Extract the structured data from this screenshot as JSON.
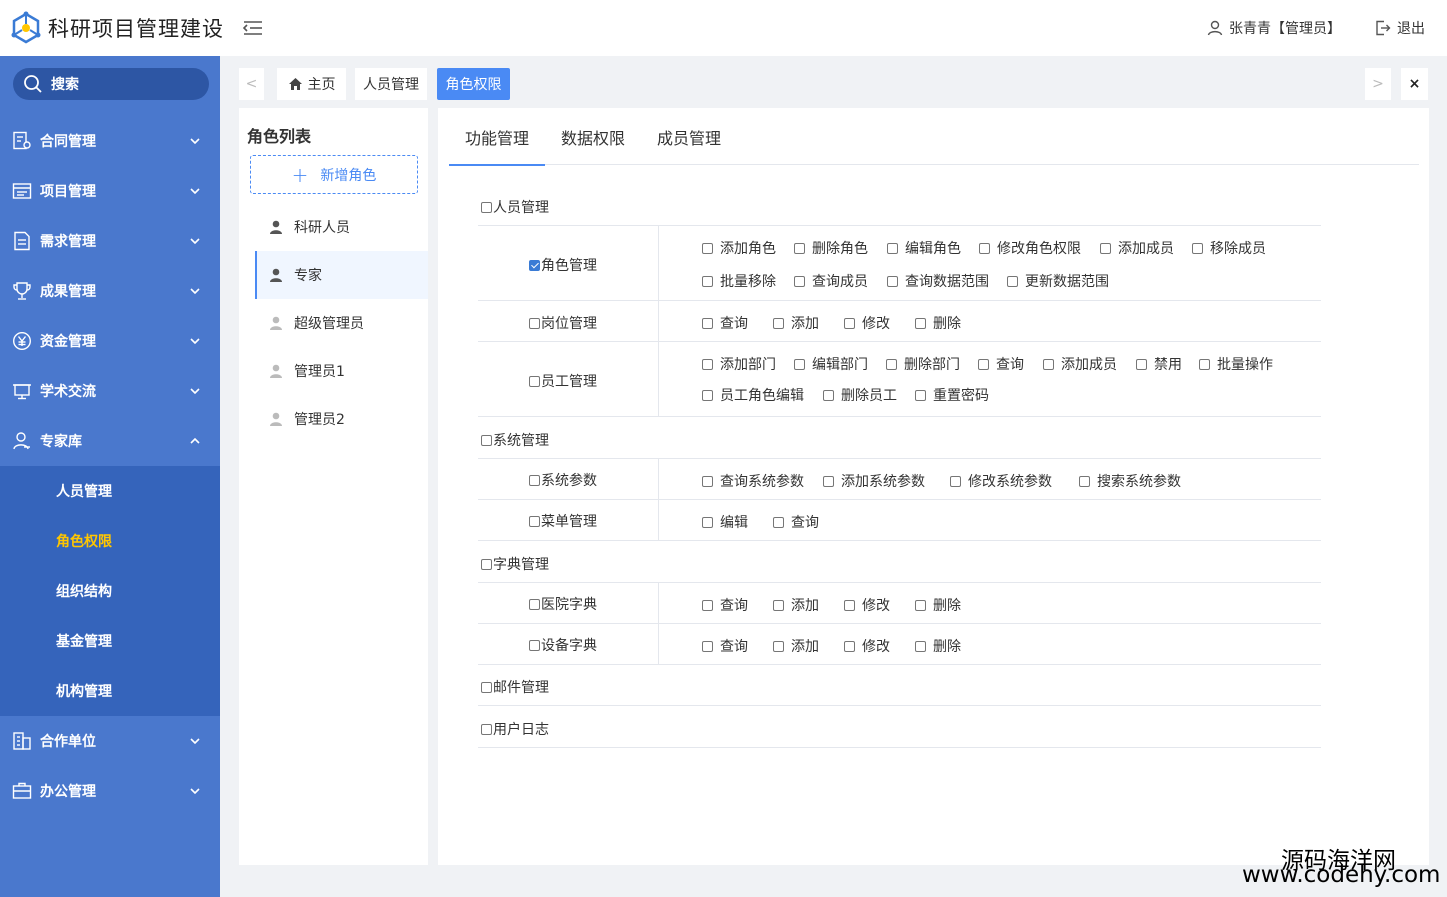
{
  "header": {
    "app_title": "科研项目管理建设",
    "user": "张青青【管理员】",
    "logout": "退出"
  },
  "sidebar": {
    "search": "搜索",
    "items": [
      {
        "label": "合同管理",
        "icon": "contract-icon"
      },
      {
        "label": "项目管理",
        "icon": "project-icon"
      },
      {
        "label": "需求管理",
        "icon": "document-icon"
      },
      {
        "label": "成果管理",
        "icon": "trophy-icon"
      },
      {
        "label": "资金管理",
        "icon": "yen-icon"
      },
      {
        "label": "学术交流",
        "icon": "monitor-icon"
      },
      {
        "label": "专家库",
        "icon": "expert-icon"
      },
      {
        "label": "合作单位",
        "icon": "building-icon"
      },
      {
        "label": "办公管理",
        "icon": "briefcase-icon"
      }
    ],
    "submenu": [
      "人员管理",
      "角色权限",
      "组织结构",
      "基金管理",
      "机构管理"
    ]
  },
  "tabs": {
    "prev": "<",
    "next": ">",
    "close": "×",
    "home": "主页",
    "people": "人员管理",
    "role": "角色权限"
  },
  "role_panel": {
    "title": "角色列表",
    "add_button": "新增角色",
    "roles": [
      "科研人员",
      "专家",
      "超级管理员",
      "管理员1",
      "管理员2"
    ]
  },
  "main_tabs": [
    "功能管理",
    "数据权限",
    "成员管理"
  ],
  "permissions": {
    "groups": [
      {
        "label": "人员管理",
        "checked": false
      },
      {
        "label": "系统管理",
        "checked": false
      },
      {
        "label": "字典管理",
        "checked": false
      },
      {
        "label": "邮件管理",
        "checked": false
      },
      {
        "label": "用户日志",
        "checked": false
      }
    ],
    "subs": [
      {
        "label": "角色管理",
        "checked": true,
        "ops": [
          "添加角色",
          "删除角色",
          "编辑角色",
          "修改角色权限",
          "添加成员",
          "移除成员",
          "批量移除",
          "查询成员",
          "查询数据范围",
          "更新数据范围"
        ]
      },
      {
        "label": "岗位管理",
        "checked": false,
        "ops": [
          "查询",
          "添加",
          "修改",
          "删除"
        ]
      },
      {
        "label": "员工管理",
        "checked": false,
        "ops": [
          "添加部门",
          "编辑部门",
          "删除部门",
          "查询",
          "添加成员",
          "禁用",
          "批量操作",
          "员工角色编辑",
          "删除员工",
          "重置密码"
        ]
      },
      {
        "label": "系统参数",
        "checked": false,
        "ops": [
          "查询系统参数",
          "添加系统参数",
          "修改系统参数",
          "搜索系统参数"
        ]
      },
      {
        "label": "菜单管理",
        "checked": false,
        "ops": [
          "编辑",
          "查询"
        ]
      },
      {
        "label": "医院字典",
        "checked": false,
        "ops": [
          "查询",
          "添加",
          "修改",
          "删除"
        ]
      },
      {
        "label": "设备字典",
        "checked": false,
        "ops": [
          "查询",
          "添加",
          "修改",
          "删除"
        ]
      }
    ]
  },
  "watermark": {
    "line1": "源码海洋网",
    "line2": "www.codehy.com"
  },
  "colors": {
    "sidebar": "#4a78cd",
    "submenu": "#3564bb",
    "accent": "#4a8af4",
    "active_sub": "#ffc600"
  }
}
